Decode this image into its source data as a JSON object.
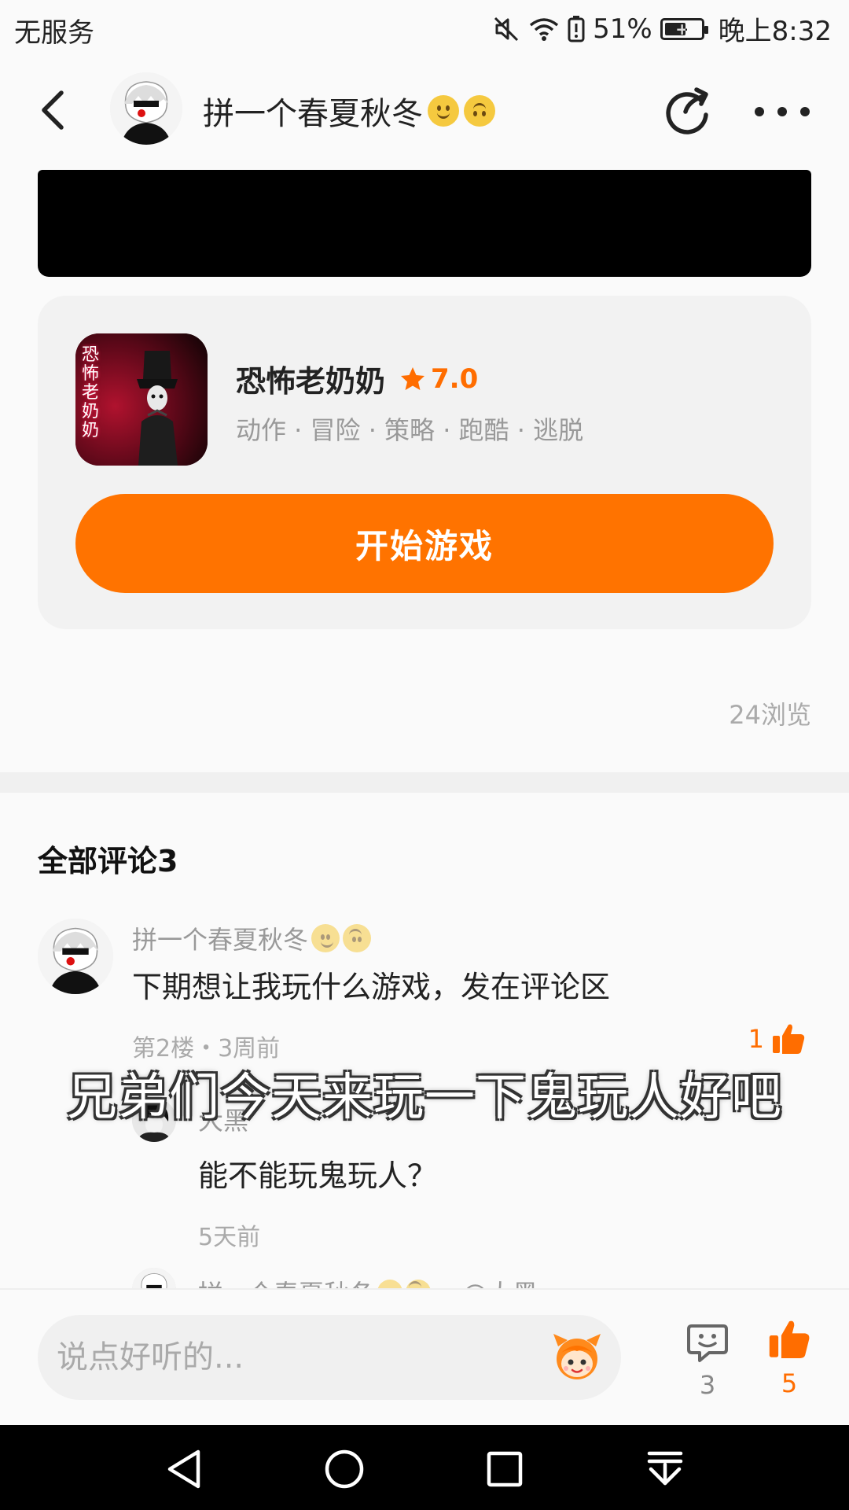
{
  "status_bar": {
    "carrier": "无服务",
    "battery": "51%",
    "time": "晚上8:32"
  },
  "header": {
    "title": "拼一个春夏秋冬"
  },
  "game_card": {
    "name": "恐怖老奶奶",
    "rating": "7.0",
    "tags": "动作 · 冒险 · 策略 · 跑酷 · 逃脱",
    "icon_text": "恐怖老奶奶",
    "start_button": "开始游戏"
  },
  "views": "24浏览",
  "comments": {
    "header": "全部评论3",
    "items": [
      {
        "author": "拼一个春夏秋冬",
        "text": "下期想让我玩什么游戏，发在评论区",
        "meta": "第2楼・3周前",
        "likes": "1",
        "replies": [
          {
            "author": "大黑",
            "text": "能不能玩鬼玩人？",
            "time": "5天前"
          },
          {
            "author": "拼一个春夏秋冬",
            "mention": "▸ @大黑"
          }
        ]
      }
    ]
  },
  "overlay_subtitle": "兄弟们今天来玩一下鬼玩人好吧",
  "bottom_bar": {
    "input_placeholder": "说点好听的...",
    "comment_count": "3",
    "like_count": "5"
  },
  "colors": {
    "accent": "#ff7300",
    "accent_text": "#ff6d00"
  }
}
